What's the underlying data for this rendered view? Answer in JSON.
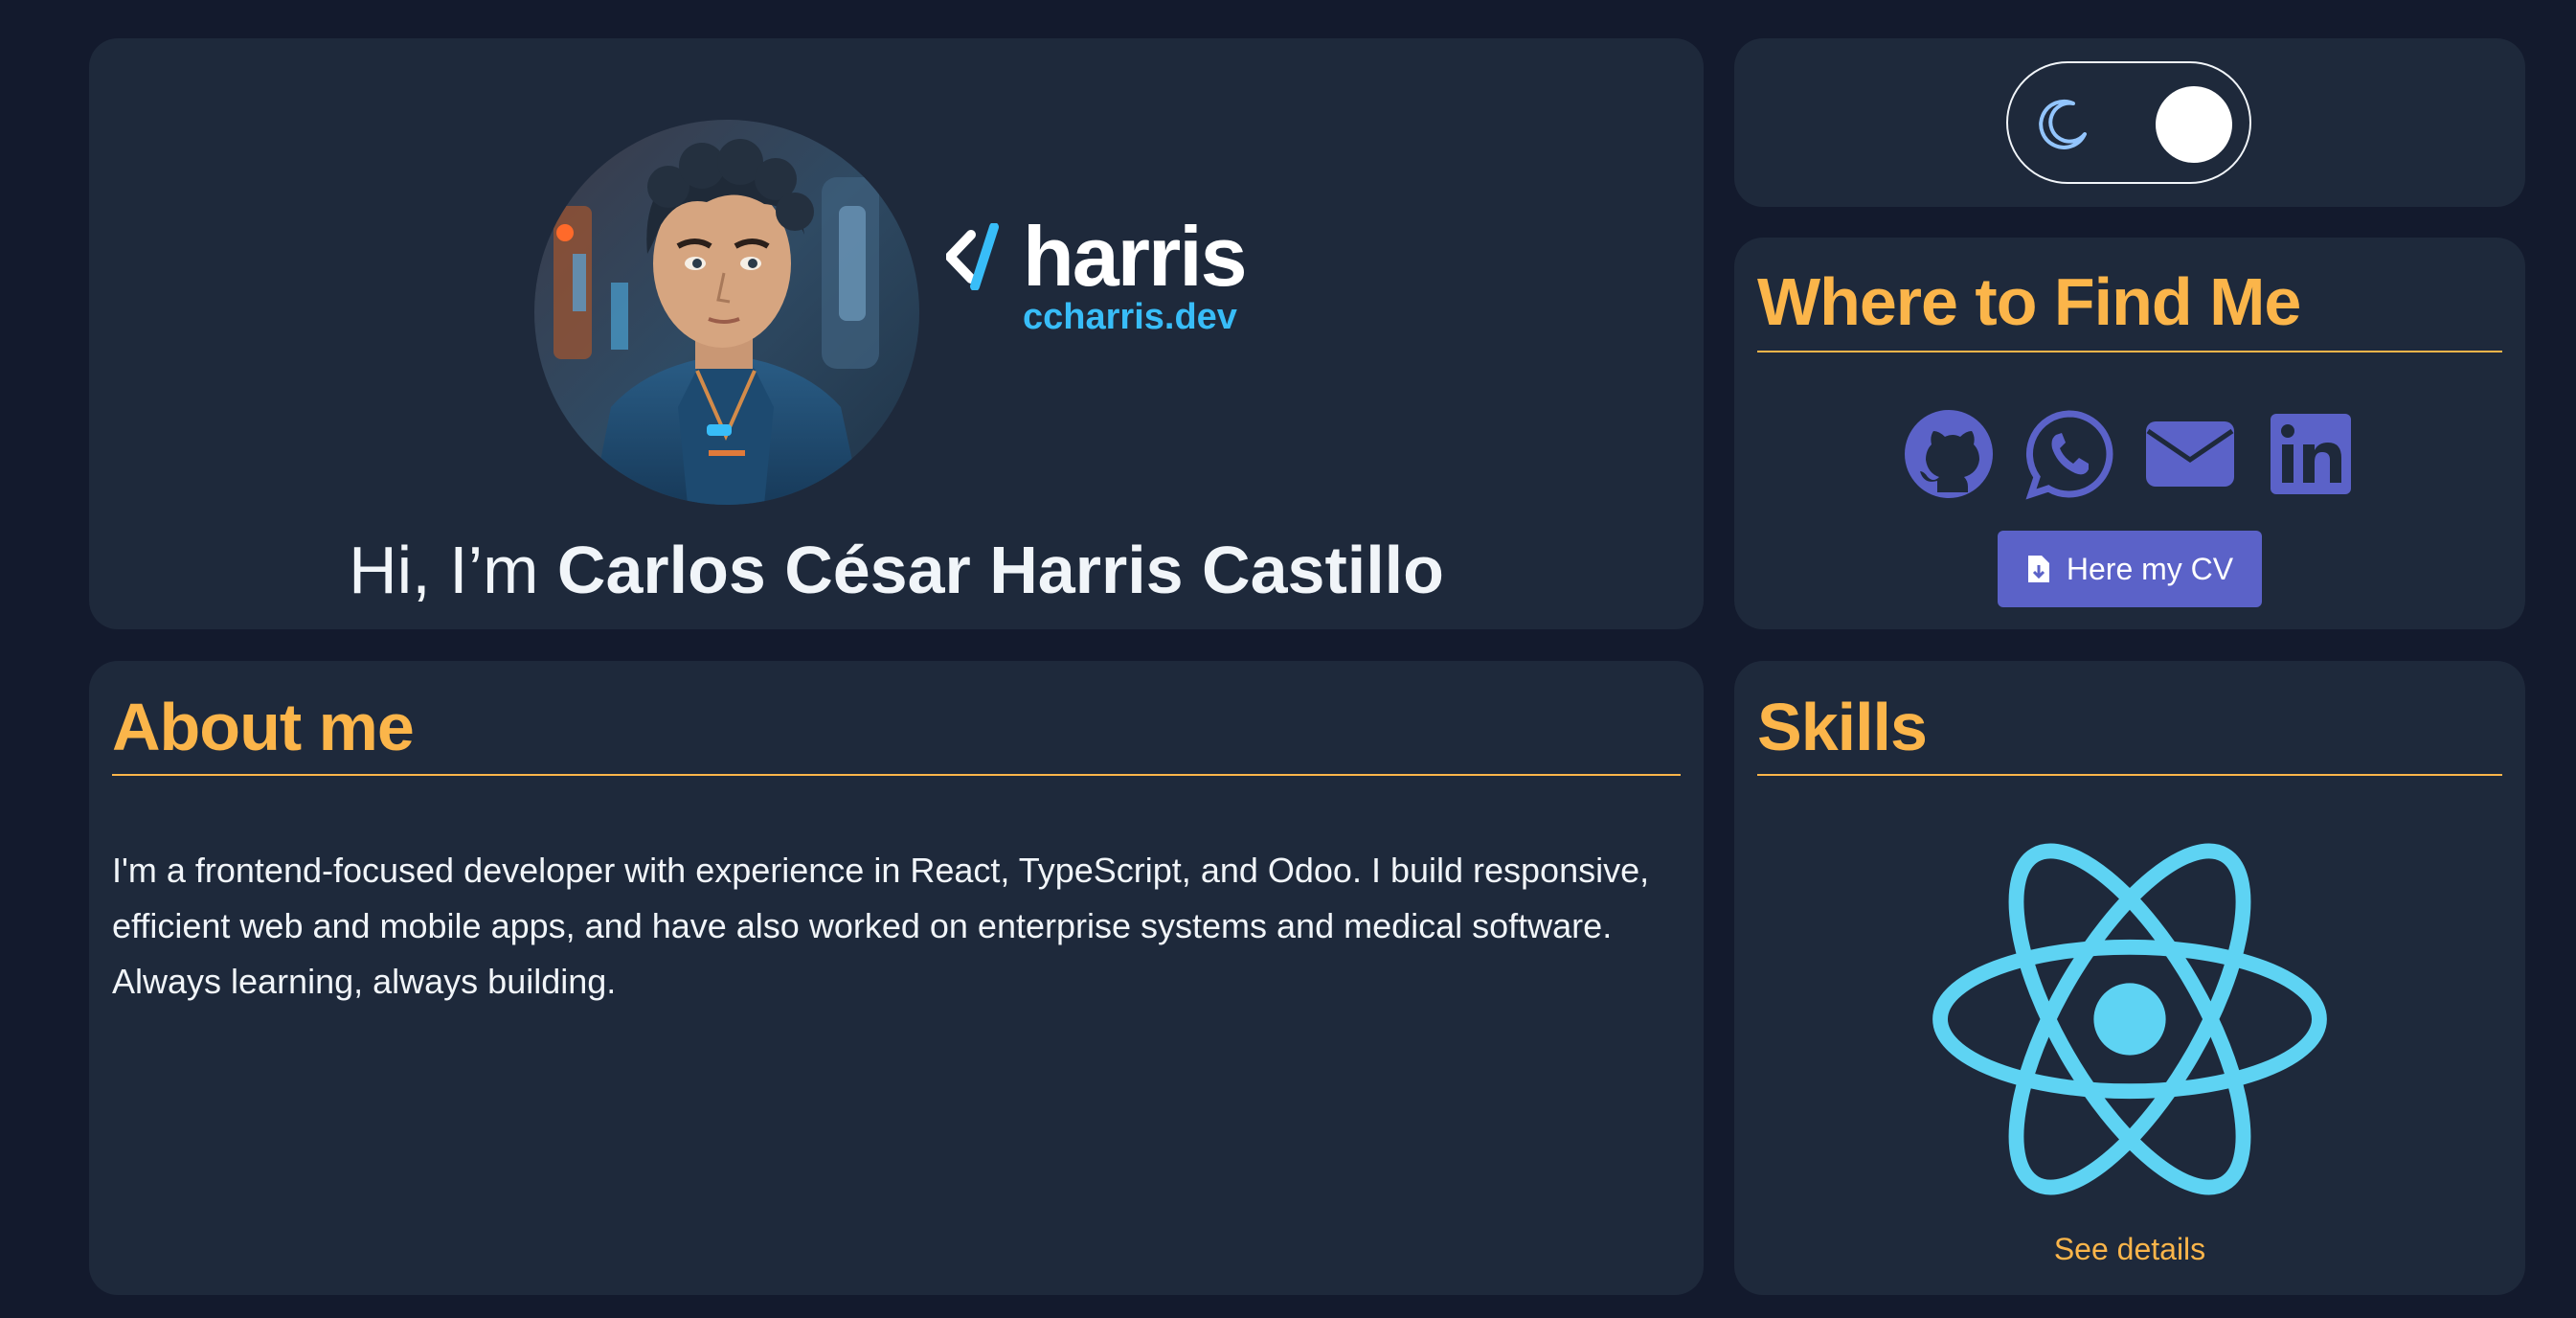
{
  "hero": {
    "avatar_alt": "Illustrated portrait avatar",
    "logo_text": "harris",
    "logo_domain": "ccharris.dev",
    "greeting_prefix": "Hi, I’m ",
    "name": "Carlos César Harris Castillo"
  },
  "theme_toggle": {
    "icon": "moon-icon",
    "state": "dark"
  },
  "find_me": {
    "title": "Where to Find Me",
    "links": [
      {
        "icon": "github-icon"
      },
      {
        "icon": "whatsapp-icon"
      },
      {
        "icon": "email-icon"
      },
      {
        "icon": "linkedin-icon"
      }
    ],
    "cv_button": "Here my CV"
  },
  "about": {
    "title": "About me",
    "text": "I'm a frontend-focused developer with experience in React, TypeScript, and Odoo. I build responsive, efficient web and mobile apps, and have also worked on enterprise systems and medical software. Always learning, always building."
  },
  "skills": {
    "title": "Skills",
    "icon": "react-icon",
    "link": "See details"
  },
  "colors": {
    "page_bg": "#131a2d",
    "card_bg": "#1e293b",
    "accent": "#fbb54a",
    "social": "#5b62c8",
    "link_blue": "#38bdf8",
    "react": "#5ed3f3"
  }
}
